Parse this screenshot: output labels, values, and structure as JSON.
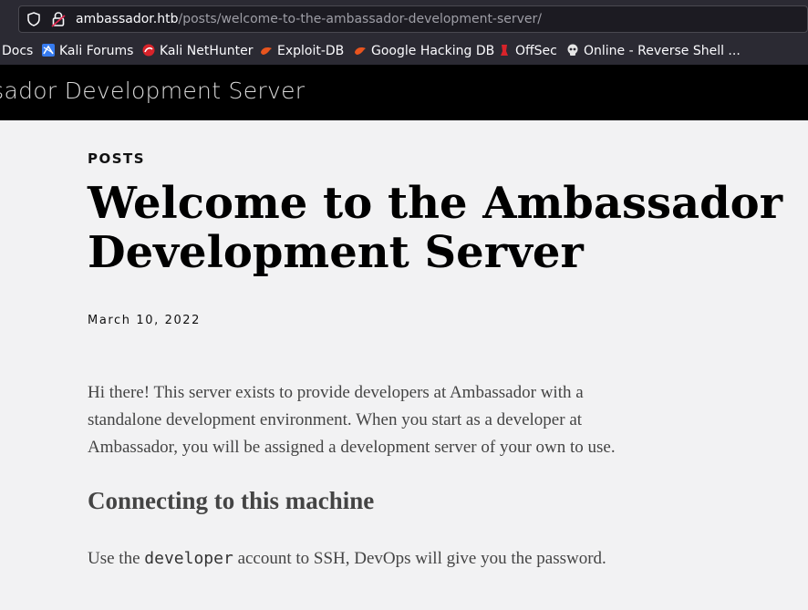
{
  "browser": {
    "url_host": "ambassador.htb",
    "url_path": "/posts/welcome-to-the-ambassador-development-server/",
    "bookmarks": [
      {
        "label": "Docs",
        "icon": "docs-icon"
      },
      {
        "label": "Kali Forums",
        "icon": "kali-forums-icon"
      },
      {
        "label": "Kali NetHunter",
        "icon": "nethunter-icon"
      },
      {
        "label": "Exploit-DB",
        "icon": "exploit-db-icon"
      },
      {
        "label": "Google Hacking DB",
        "icon": "ghdb-icon"
      },
      {
        "label": "OffSec",
        "icon": "offsec-icon"
      },
      {
        "label": "Online - Reverse Shell ...",
        "icon": "skull-icon"
      }
    ]
  },
  "site": {
    "title": "Ambassador Development Server"
  },
  "post": {
    "category": "POSTS",
    "title": "Welcome to the Ambassador Development Server",
    "date": "March 10, 2022",
    "intro": "Hi there! This server exists to provide developers at Ambassador with a standalone development environment. When you start as a developer at Ambassador, you will be assigned a development server of your own to use.",
    "section_heading": "Connecting to this machine",
    "ssh_before": "Use the ",
    "ssh_code": "developer",
    "ssh_after": " account to SSH, DevOps will give you the password."
  }
}
